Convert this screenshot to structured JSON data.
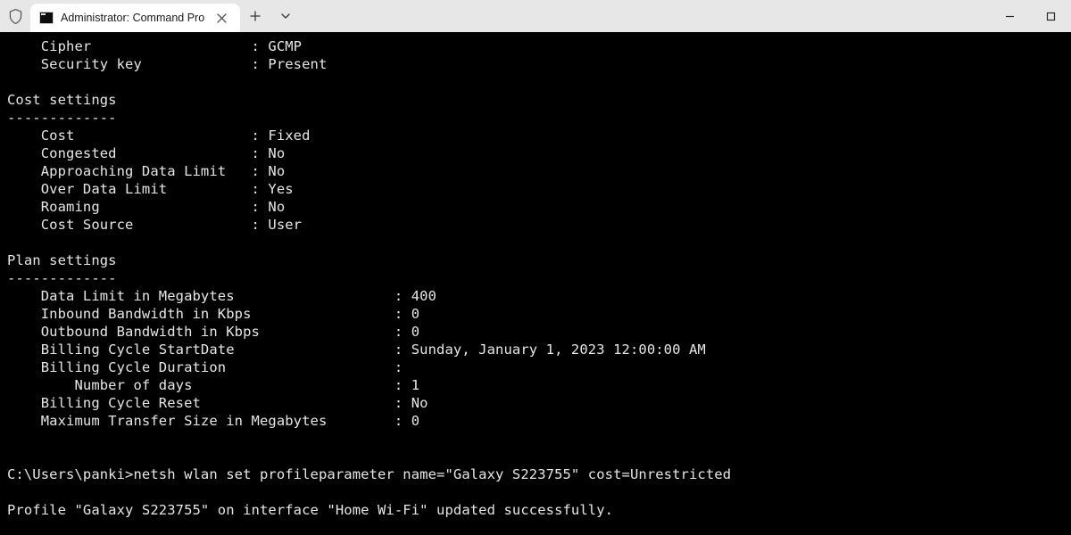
{
  "window": {
    "tab_title": "Administrator: Command Pro",
    "shield_tooltip": "Shield"
  },
  "output": {
    "pre_rows": [
      {
        "label": "Cipher",
        "value": "GCMP"
      },
      {
        "label": "Security key",
        "value": "Present"
      }
    ],
    "cost_header": "Cost settings",
    "cost_rule": "-------------",
    "cost_rows": [
      {
        "label": "Cost",
        "value": "Fixed"
      },
      {
        "label": "Congested",
        "value": "No"
      },
      {
        "label": "Approaching Data Limit",
        "value": "No"
      },
      {
        "label": "Over Data Limit",
        "value": "Yes"
      },
      {
        "label": "Roaming",
        "value": "No"
      },
      {
        "label": "Cost Source",
        "value": "User"
      }
    ],
    "plan_header": "Plan settings",
    "plan_rule": "-------------",
    "plan_rows": [
      {
        "label": "Data Limit in Megabytes",
        "value": "400"
      },
      {
        "label": "Inbound Bandwidth in Kbps",
        "value": "0"
      },
      {
        "label": "Outbound Bandwidth in Kbps",
        "value": "0"
      },
      {
        "label": "Billing Cycle StartDate",
        "value": "Sunday, January 1, 2023 12:00:00 AM"
      },
      {
        "label": "Billing Cycle Duration",
        "value": ""
      },
      {
        "label": "    Number of days",
        "value": "1",
        "sub": true
      },
      {
        "label": "Billing Cycle Reset",
        "value": "No"
      },
      {
        "label": "Maximum Transfer Size in Megabytes",
        "value": "0"
      }
    ],
    "prompt": "C:\\Users\\panki>",
    "command": "netsh wlan set profileparameter name=\"Galaxy S223755\" cost=Unrestricted",
    "result": "Profile \"Galaxy S223755\" on interface \"Home Wi-Fi\" updated successfully."
  },
  "layout": {
    "pre_col": 25,
    "cost_col": 25,
    "plan_col": 42
  }
}
